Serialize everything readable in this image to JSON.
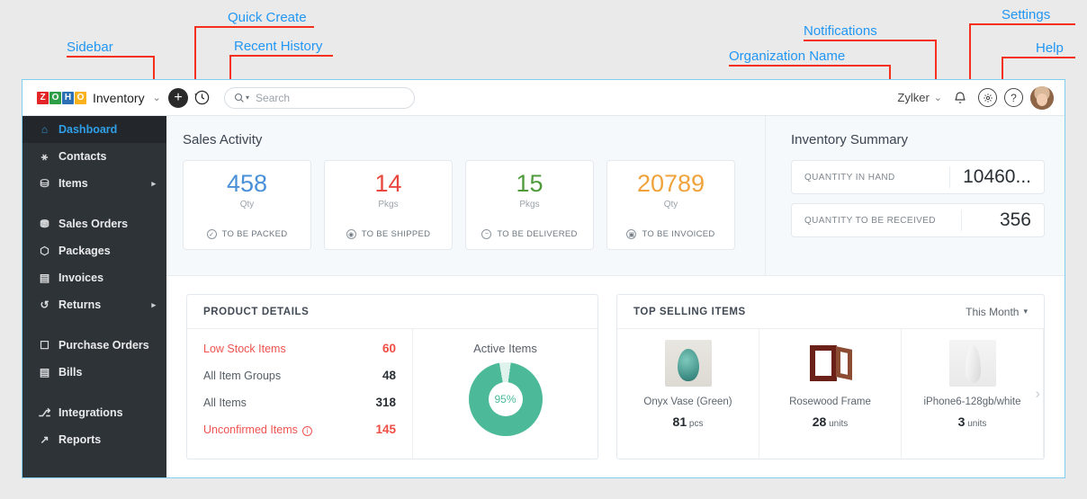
{
  "annotations": [
    {
      "label": "Sidebar"
    },
    {
      "label": "Quick Create"
    },
    {
      "label": "Recent History"
    },
    {
      "label": "Organization Name"
    },
    {
      "label": "Notifications"
    },
    {
      "label": "Settings"
    },
    {
      "label": "Help"
    }
  ],
  "header": {
    "logo_tiles": [
      "Z",
      "O",
      "H",
      "O"
    ],
    "product": "Inventory",
    "caret": "⌄",
    "quick_create_icon": "+",
    "recent_history_icon": "↺",
    "search": {
      "placeholder": "Search",
      "icon": "search-icon",
      "caret": "▾"
    },
    "org_name": "Zylker",
    "org_caret": "⌄",
    "notifications_icon": "✧",
    "settings_icon": "⚙",
    "help_icon": "?"
  },
  "sidebar": {
    "items": [
      {
        "label": "Dashboard",
        "icon": "⌂",
        "active": true,
        "arrow": "",
        "gap_after": false
      },
      {
        "label": "Contacts",
        "icon": "⚹",
        "active": false,
        "arrow": "",
        "gap_after": false
      },
      {
        "label": "Items",
        "icon": "⛁",
        "active": false,
        "arrow": "▸",
        "gap_after": true
      },
      {
        "label": "Sales Orders",
        "icon": "⛃",
        "active": false,
        "arrow": "",
        "gap_after": false
      },
      {
        "label": "Packages",
        "icon": "⬡",
        "active": false,
        "arrow": "",
        "gap_after": false
      },
      {
        "label": "Invoices",
        "icon": "▤",
        "active": false,
        "arrow": "",
        "gap_after": false
      },
      {
        "label": "Returns",
        "icon": "↺",
        "active": false,
        "arrow": "▸",
        "gap_after": true
      },
      {
        "label": "Purchase Orders",
        "icon": "☐",
        "active": false,
        "arrow": "",
        "gap_after": false
      },
      {
        "label": "Bills",
        "icon": "▤",
        "active": false,
        "arrow": "",
        "gap_after": true
      },
      {
        "label": "Integrations",
        "icon": "⎇",
        "active": false,
        "arrow": "",
        "gap_after": false
      },
      {
        "label": "Reports",
        "icon": "↗",
        "active": false,
        "arrow": "",
        "gap_after": false
      }
    ]
  },
  "sales_activity": {
    "title": "Sales Activity",
    "cards": [
      {
        "value": "458",
        "unit": "Qty",
        "label": "TO BE PACKED",
        "color": "#4a90d9",
        "icon": "✓"
      },
      {
        "value": "14",
        "unit": "Pkgs",
        "label": "TO BE SHIPPED",
        "color": "#e8483f",
        "icon": "◉"
      },
      {
        "value": "15",
        "unit": "Pkgs",
        "label": "TO BE DELIVERED",
        "color": "#4f9b3c",
        "icon": "−"
      },
      {
        "value": "20789",
        "unit": "Qty",
        "label": "TO BE INVOICED",
        "color": "#f0a33c",
        "icon": "▣"
      }
    ]
  },
  "inventory_summary": {
    "title": "Inventory Summary",
    "rows": [
      {
        "label": "QUANTITY IN HAND",
        "value": "10460..."
      },
      {
        "label": "QUANTITY TO BE RECEIVED",
        "value": "356"
      }
    ]
  },
  "product_details": {
    "title": "PRODUCT DETAILS",
    "rows": [
      {
        "name": "Low Stock Items",
        "value": "60",
        "red": true,
        "info": false
      },
      {
        "name": "All Item Groups",
        "value": "48",
        "red": false,
        "info": false
      },
      {
        "name": "All Items",
        "value": "318",
        "red": false,
        "info": false
      },
      {
        "name": "Unconfirmed Items",
        "value": "145",
        "red": true,
        "info": true
      }
    ],
    "chart_title": "Active Items",
    "chart_percent": "95%"
  },
  "chart_data": {
    "type": "pie",
    "title": "Active Items",
    "categories": [
      "Active",
      "Inactive"
    ],
    "values": [
      95,
      5
    ],
    "colors": [
      "#4cba99",
      "#dff2ec"
    ],
    "legend": "none",
    "annotations": [
      "95%"
    ]
  },
  "top_selling": {
    "title": "TOP SELLING ITEMS",
    "period": "This Month",
    "period_caret": "▾",
    "next_arrow": "›",
    "items": [
      {
        "name": "Onyx Vase (Green)",
        "qty": "81",
        "unit": "pcs",
        "image": "vase-image"
      },
      {
        "name": "Rosewood Frame",
        "qty": "28",
        "unit": "units",
        "image": "frame-image"
      },
      {
        "name": "iPhone6-128gb/white",
        "qty": "3",
        "unit": "units",
        "image": "iphone-image"
      }
    ]
  },
  "colors": {
    "annotation_label": "#2196f3",
    "annotation_line": "#f5311d",
    "sidebar_bg": "#2e3338",
    "accent_teal": "#4cba99",
    "window_border": "#7fd0f0"
  }
}
